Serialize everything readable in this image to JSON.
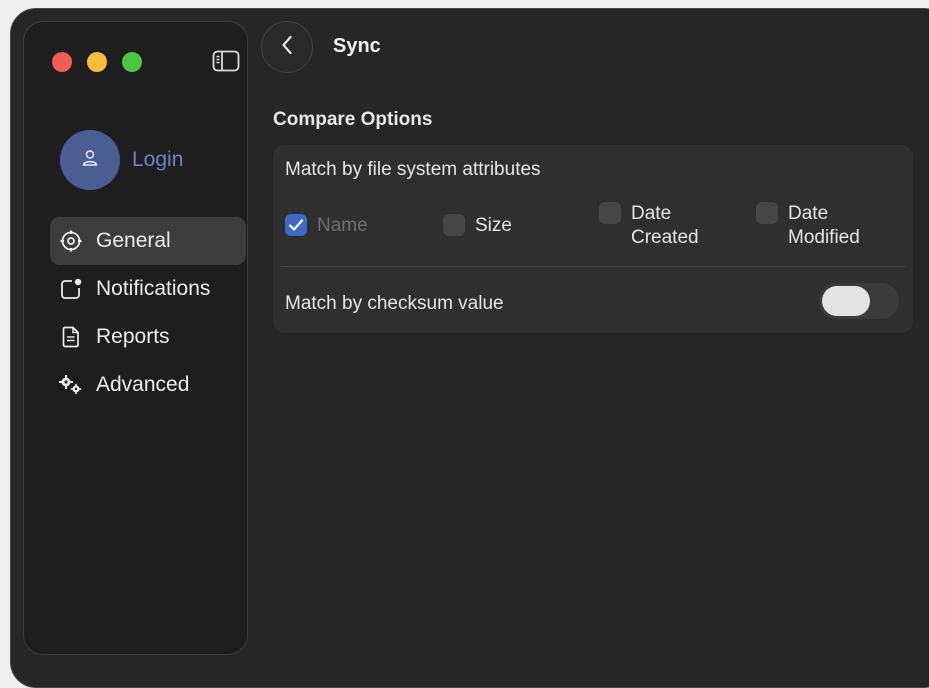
{
  "window": {
    "title": "Sync",
    "colors": {
      "background": "#262626",
      "sidebar": "#1e1e1e",
      "accent": "#3f68c5",
      "avatar": "#4b5e93",
      "login_text": "#6d84c4"
    }
  },
  "sidebar": {
    "login_label": "Login",
    "avatar_icon": "person-icon",
    "items": [
      {
        "label": "General",
        "icon": "gear-icon",
        "active": true
      },
      {
        "label": "Notifications",
        "icon": "notification-icon",
        "active": false
      },
      {
        "label": "Reports",
        "icon": "document-icon",
        "active": false
      },
      {
        "label": "Advanced",
        "icon": "gears-icon",
        "active": false
      }
    ]
  },
  "main": {
    "section_title": "Compare Options",
    "attributes": {
      "label": "Match by file system attributes",
      "options": [
        {
          "label": "Name",
          "checked": true,
          "disabled": true
        },
        {
          "label": "Size",
          "checked": false,
          "disabled": false
        },
        {
          "label_line1": "Date",
          "label_line2": "Created",
          "checked": false,
          "disabled": false
        },
        {
          "label_line1": "Date",
          "label_line2": "Modified",
          "checked": false,
          "disabled": false
        }
      ]
    },
    "checksum": {
      "label": "Match by checksum value",
      "enabled": false
    }
  }
}
